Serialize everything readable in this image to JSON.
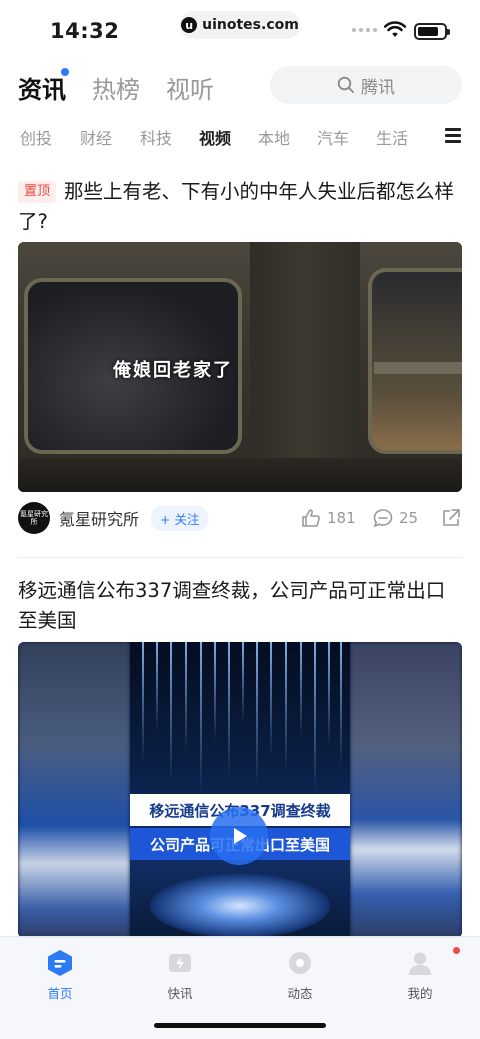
{
  "status_bar": {
    "time": "14:32",
    "url": "uinotes.com"
  },
  "header": {
    "tabs": [
      {
        "label": "资讯",
        "active": true
      },
      {
        "label": "热榜",
        "active": false
      },
      {
        "label": "视听",
        "active": false
      }
    ],
    "search_placeholder": "腾讯"
  },
  "categories": [
    {
      "label": "创投",
      "active": false
    },
    {
      "label": "财经",
      "active": false
    },
    {
      "label": "科技",
      "active": false
    },
    {
      "label": "视频",
      "active": true
    },
    {
      "label": "本地",
      "active": false
    },
    {
      "label": "汽车",
      "active": false
    },
    {
      "label": "生活",
      "active": false
    }
  ],
  "articles": [
    {
      "badge": "置顶",
      "title": "那些上有老、下有小的中年人失业后都怎么样了?",
      "video_caption": "俺娘回老家了",
      "author": "氪星研究所",
      "avatar_text": "氪星研究所",
      "follow": "+ 关注",
      "likes": "181",
      "comments": "25"
    },
    {
      "title": "移远通信公布337调查终裁，公司产品可正常出口至美国",
      "video_band_1": "移远通信公布337调查终裁",
      "video_band_2": "公司产品可正常出口至美国"
    }
  ],
  "bottom_tabs": [
    {
      "label": "首页",
      "active": true
    },
    {
      "label": "快讯",
      "active": false
    },
    {
      "label": "动态",
      "active": false
    },
    {
      "label": "我的",
      "active": false
    }
  ],
  "colors": {
    "accent": "#2d7bf4",
    "pin_badge": "#e8473c",
    "notification_dot": "#f04a4a"
  }
}
